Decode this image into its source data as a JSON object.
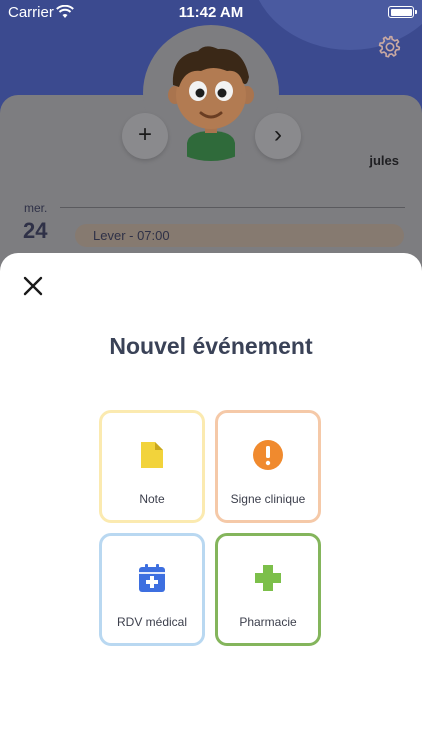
{
  "status_bar": {
    "carrier": "Carrier",
    "time": "11:42 AM"
  },
  "profile": {
    "username": "jules",
    "add_label": "+",
    "next_label": "›"
  },
  "calendar": {
    "day_name": "mer.",
    "day_number": "24",
    "event": "Lever - 07:00"
  },
  "sheet": {
    "title": "Nouvel événement",
    "tiles": [
      {
        "label": "Note",
        "icon": "note-icon",
        "color": "#f2d33b"
      },
      {
        "label": "Signe clinique",
        "icon": "exclamation-icon",
        "color": "#f08a2e"
      },
      {
        "label": "RDV médical",
        "icon": "medical-calendar-icon",
        "color": "#3d6fe0"
      },
      {
        "label": "Pharmacie",
        "icon": "pharmacy-cross-icon",
        "color": "#7cbf4a"
      }
    ]
  },
  "colors": {
    "header": "#3b4a8f",
    "title": "#3a4257"
  }
}
